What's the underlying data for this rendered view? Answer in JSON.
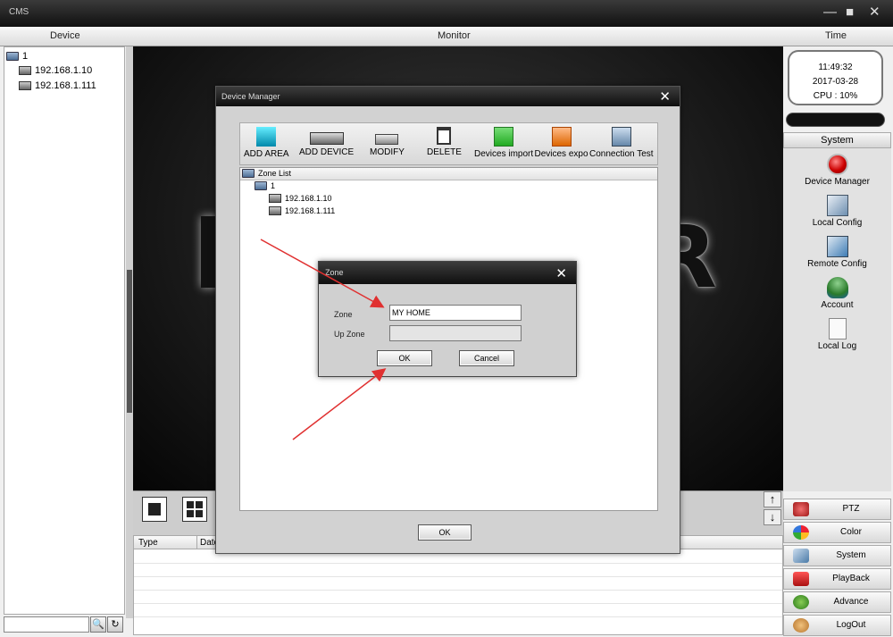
{
  "window": {
    "title": "CMS",
    "minimize": "—",
    "maximize": "■",
    "close": "✕"
  },
  "columns": {
    "device": "Device",
    "monitor": "Monitor",
    "time": "Time"
  },
  "left_tree": {
    "root": "1",
    "items": [
      "192.168.1.10",
      "192.168.1.111"
    ]
  },
  "left_search": {
    "value": "",
    "search_icon": "magnifier",
    "refresh_icon": "refresh"
  },
  "monitor": {
    "background_letter": "R"
  },
  "log_table": {
    "headers": [
      "Type",
      "Date"
    ]
  },
  "clock": {
    "time": "11:49:32",
    "date": "2017-03-28",
    "cpu": "CPU : 10%"
  },
  "system": {
    "header": "System",
    "items": [
      {
        "label": "Device Manager",
        "icon": "red-button-icon",
        "color": "#d21010"
      },
      {
        "label": "Local Config",
        "icon": "local-config-icon",
        "color": "#6d8fb0"
      },
      {
        "label": "Remote Config",
        "icon": "remote-config-icon",
        "color": "#3f7db5"
      },
      {
        "label": "Account",
        "icon": "users-icon",
        "color": "#3a8f3a"
      },
      {
        "label": "Local Log",
        "icon": "document-icon",
        "color": "#f4f4f4"
      }
    ]
  },
  "bottom_nav": [
    {
      "label": "PTZ",
      "icon": "ptz-icon",
      "color": "#c83232"
    },
    {
      "label": "Color",
      "icon": "color-wheel-icon",
      "color": "#e08a1e"
    },
    {
      "label": "System",
      "icon": "system-icon",
      "color": "#4a7aa8"
    },
    {
      "label": "PlayBack",
      "icon": "playback-icon",
      "color": "#c81e2a"
    },
    {
      "label": "Advance",
      "icon": "advance-icon",
      "color": "#3a9a2a"
    },
    {
      "label": "LogOut",
      "icon": "logout-icon",
      "color": "#d8a040"
    }
  ],
  "device_manager": {
    "title": "Device Manager",
    "close": "✕",
    "toolbar": [
      {
        "label": "ADD AREA",
        "icon": "add-area-icon"
      },
      {
        "label": "ADD DEVICE",
        "icon": "add-device-icon"
      },
      {
        "label": "MODIFY",
        "icon": "modify-icon"
      },
      {
        "label": "DELETE",
        "icon": "delete-icon"
      },
      {
        "label": "Devices import",
        "icon": "import-icon"
      },
      {
        "label": "Devices expo",
        "icon": "export-icon"
      },
      {
        "label": "Connection Test",
        "icon": "connection-test-icon"
      }
    ],
    "tree": {
      "root": "Zone List",
      "zone": "1",
      "devices": [
        "192.168.1.10",
        "192.168.1.111"
      ]
    },
    "ok_button": "OK"
  },
  "zone_dialog": {
    "title": "Zone",
    "close": "✕",
    "zone_label": "Zone",
    "zone_value": "MY HOME",
    "up_zone_label": "Up Zone",
    "up_zone_value": "",
    "ok": "OK",
    "cancel": "Cancel"
  },
  "colors": {
    "annotation_arrow": "#e03030",
    "title_bar": "#1a1a1a"
  }
}
